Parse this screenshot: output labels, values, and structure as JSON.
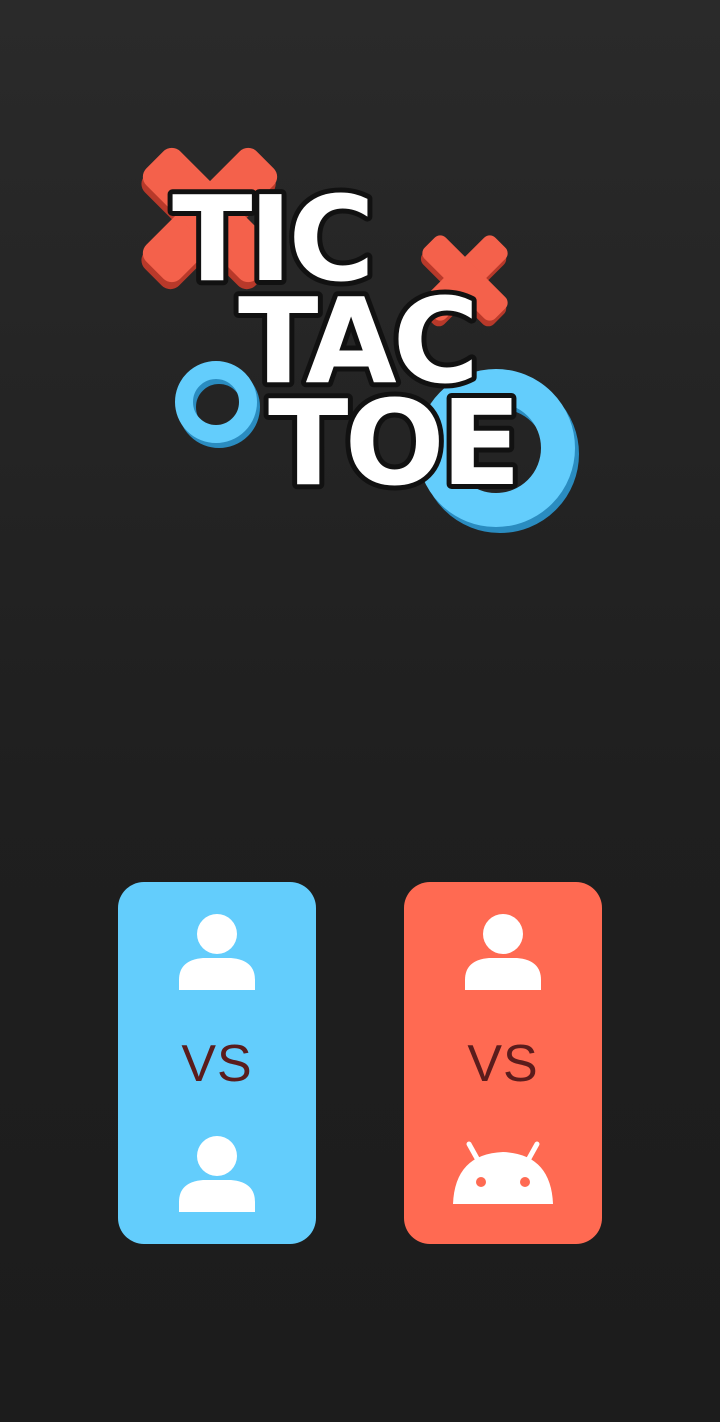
{
  "logo": {
    "line1": "TIC",
    "line2": "TAC",
    "line3": "TOE",
    "x_color": "#f4614b",
    "o_color": "#63cdfc",
    "text_color": "#ffffff",
    "outline_color": "#111111"
  },
  "modes": [
    {
      "id": "player-vs-player",
      "vs_label": "VS",
      "top_icon": "person-icon",
      "bottom_icon": "person-icon",
      "background": "#63cdfc"
    },
    {
      "id": "player-vs-computer",
      "vs_label": "VS",
      "top_icon": "person-icon",
      "bottom_icon": "android-icon",
      "background": "#ff6a52"
    }
  ],
  "colors": {
    "background": "#212121",
    "vs_text": "#5a1c1c",
    "icon_fill": "#ffffff"
  }
}
